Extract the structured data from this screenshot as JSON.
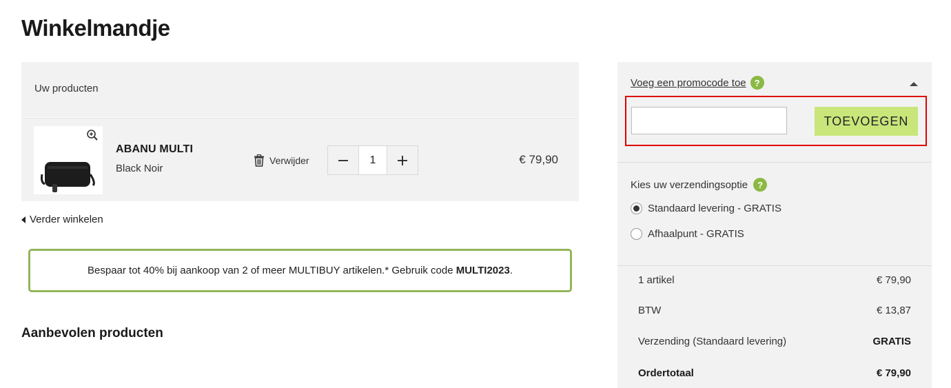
{
  "page": {
    "title": "Winkelmandje"
  },
  "products": {
    "header": "Uw producten",
    "items": [
      {
        "name": "ABANU MULTI",
        "variant": "Black Noir",
        "remove_label": "Verwijder",
        "quantity": "1",
        "price": "€ 79,90"
      }
    ]
  },
  "continue_shopping": "Verder winkelen",
  "promo_banner": {
    "text_before": "Bespaar tot 40% bij aankoop van 2 of meer MULTIBUY artikelen.* Gebruik code ",
    "code": "MULTI2023",
    "text_after": "."
  },
  "recommended_title": "Aanbevolen producten",
  "sidebar": {
    "promo_link": "Voeg een promocode toe",
    "help_mark": "?",
    "promo_input": {
      "value": "",
      "placeholder": ""
    },
    "promo_button": "TOEVOEGEN",
    "shipping_title": "Kies uw verzendingsoptie",
    "shipping_options": [
      {
        "label": "Standaard levering - GRATIS",
        "selected": true
      },
      {
        "label": "Afhaalpunt - GRATIS",
        "selected": false
      }
    ],
    "summary": [
      {
        "label": "1 artikel",
        "value": "€ 79,90"
      },
      {
        "label": "BTW",
        "value": "€ 13,87"
      },
      {
        "label": "Verzending (Standaard levering)",
        "value": "GRATIS"
      },
      {
        "label": "Ordertotaal",
        "value": "€ 79,90"
      }
    ]
  },
  "colors": {
    "accent_green": "#8bb944",
    "button_green": "#c8e67a",
    "banner_border": "#93b55a",
    "highlight_red": "#e00000",
    "panel_bg": "#f2f2f2"
  }
}
